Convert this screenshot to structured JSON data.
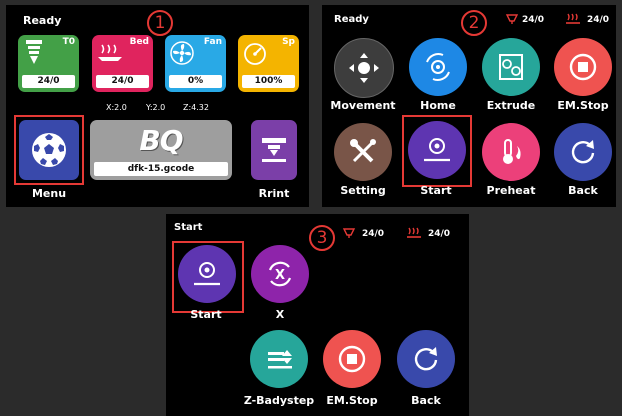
{
  "panel1": {
    "status": "Ready",
    "step_number": "1",
    "tiles": [
      {
        "label": "T0",
        "value": "24/0",
        "icon": "nozzle-icon"
      },
      {
        "label": "Bed",
        "value": "24/0",
        "icon": "bed-icon"
      },
      {
        "label": "Fan",
        "value": "0%",
        "icon": "fan-icon"
      },
      {
        "label": "Sp",
        "value": "100%",
        "icon": "speed-icon"
      }
    ],
    "coords": {
      "x": "X:2.0",
      "y": "Y:2.0",
      "z": "Z:4.32"
    },
    "menu_label": "Menu",
    "logo_text": "BQ",
    "filename": "dfk-15.gcode",
    "print_label": "Rrint"
  },
  "panel2": {
    "status": "Ready",
    "step_number": "2",
    "nozzle_temp": "24/0",
    "bed_temp": "24/0",
    "buttons": [
      {
        "label": "Movement",
        "icon": "move-icon",
        "color": "#3a3a3a"
      },
      {
        "label": "Home",
        "icon": "home-icon",
        "color": "#1e88e5"
      },
      {
        "label": "Extrude",
        "icon": "extrude-icon",
        "color": "#26a69a"
      },
      {
        "label": "EM.Stop",
        "icon": "stop-icon",
        "color": "#ef5350"
      },
      {
        "label": "Setting",
        "icon": "tools-icon",
        "color": "#795548"
      },
      {
        "label": "Start",
        "icon": "start-icon",
        "color": "#5e35b1"
      },
      {
        "label": "Preheat",
        "icon": "thermometer-icon",
        "color": "#ec407a"
      },
      {
        "label": "Back",
        "icon": "back-icon",
        "color": "#3949ab"
      }
    ]
  },
  "panel3": {
    "status": "Start",
    "step_number": "3",
    "nozzle_temp": "24/0",
    "bed_temp": "24/0",
    "buttons": [
      {
        "label": "Start",
        "icon": "start-icon",
        "color": "#5e35b1"
      },
      {
        "label": "X",
        "icon": "x-rotate-icon",
        "color": "#8e24aa"
      },
      {
        "label": "Z-Badystep",
        "icon": "z-babystep-icon",
        "color": "#26a69a"
      },
      {
        "label": "EM.Stop",
        "icon": "stop-icon",
        "color": "#ef5350"
      },
      {
        "label": "Back",
        "icon": "back-icon",
        "color": "#3949ab"
      }
    ]
  }
}
